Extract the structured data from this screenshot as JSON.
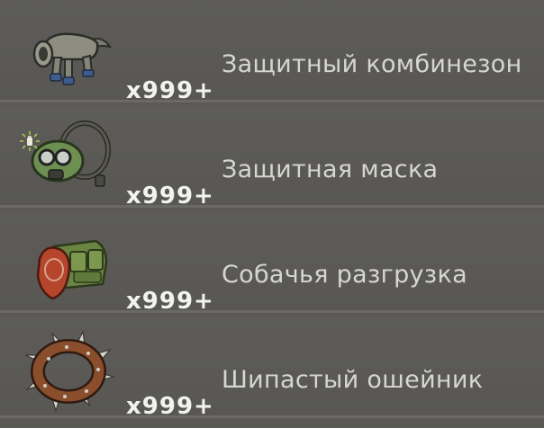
{
  "inventory": {
    "items": [
      {
        "name": "Защитный комбинезон",
        "quantity": "x999+",
        "icon": "dog-suit-icon"
      },
      {
        "name": "Защитная маска",
        "quantity": "x999+",
        "icon": "gas-mask-icon"
      },
      {
        "name": "Собачья разгрузка",
        "quantity": "x999+",
        "icon": "dog-vest-icon"
      },
      {
        "name": "Шипастый ошейник",
        "quantity": "x999+",
        "icon": "spiked-collar-icon"
      }
    ],
    "new_badge_icon": "new-item-badge-icon"
  }
}
